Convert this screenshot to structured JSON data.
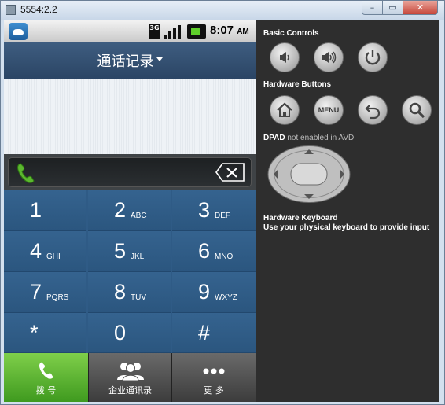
{
  "window": {
    "title": "5554:2.2",
    "minimize_label": "–",
    "maximize_label": "▭",
    "close_label": "✕"
  },
  "statusbar": {
    "network": "3G",
    "time": "8:07",
    "ampm": "AM"
  },
  "app": {
    "title": "通话记录",
    "dialed_number": ""
  },
  "keypad": {
    "keys": [
      {
        "digit": "1",
        "letters": ""
      },
      {
        "digit": "2",
        "letters": "ABC"
      },
      {
        "digit": "3",
        "letters": "DEF"
      },
      {
        "digit": "4",
        "letters": "GHI"
      },
      {
        "digit": "5",
        "letters": "JKL"
      },
      {
        "digit": "6",
        "letters": "MNO"
      },
      {
        "digit": "7",
        "letters": "PQRS"
      },
      {
        "digit": "8",
        "letters": "TUV"
      },
      {
        "digit": "9",
        "letters": "WXYZ"
      },
      {
        "digit": "*",
        "letters": ""
      },
      {
        "digit": "0",
        "letters": ""
      },
      {
        "digit": "#",
        "letters": ""
      }
    ]
  },
  "tabs": [
    {
      "label": "拨 号",
      "icon": "phone-icon",
      "active": true
    },
    {
      "label": "企业通讯录",
      "icon": "contacts-icon",
      "active": false
    },
    {
      "label": "更 多",
      "icon": "more-icon",
      "active": false
    }
  ],
  "controls": {
    "basic_title": "Basic Controls",
    "hardware_title": "Hardware Buttons",
    "menu_label": "MENU",
    "dpad_title": "DPAD",
    "dpad_note": "not enabled in AVD",
    "keyboard_title": "Hardware Keyboard",
    "keyboard_note": "Use your physical keyboard to provide input"
  },
  "colors": {
    "accent_green": "#5cb82f",
    "keypad_blue": "#2f5b86",
    "appbar": "#34516f"
  }
}
